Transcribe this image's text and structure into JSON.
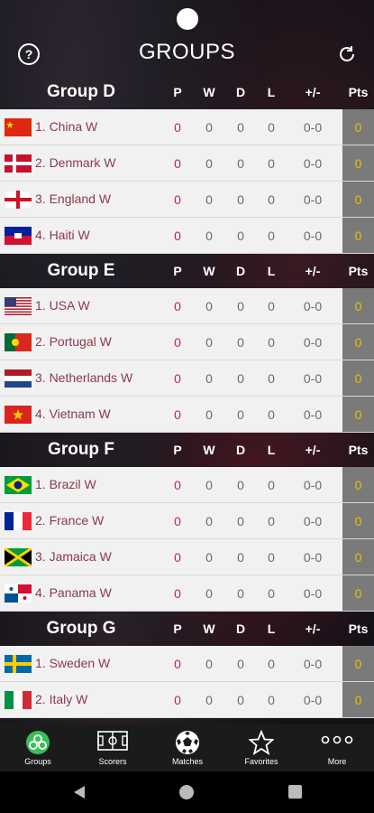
{
  "app": {
    "title": "GROUPS"
  },
  "columns": {
    "p": "P",
    "w": "W",
    "d": "D",
    "l": "L",
    "gd": "+/-",
    "pts": "Pts"
  },
  "groups": [
    {
      "name": "Group D",
      "teams": [
        {
          "pos_name": "1. China W",
          "p": "0",
          "w": "0",
          "d": "0",
          "l": "0",
          "gd": "0-0",
          "pts": "0",
          "flag": "china-flag"
        },
        {
          "pos_name": "2. Denmark W",
          "p": "0",
          "w": "0",
          "d": "0",
          "l": "0",
          "gd": "0-0",
          "pts": "0",
          "flag": "denmark-flag"
        },
        {
          "pos_name": "3. England W",
          "p": "0",
          "w": "0",
          "d": "0",
          "l": "0",
          "gd": "0-0",
          "pts": "0",
          "flag": "england-flag"
        },
        {
          "pos_name": "4. Haiti W",
          "p": "0",
          "w": "0",
          "d": "0",
          "l": "0",
          "gd": "0-0",
          "pts": "0",
          "flag": "haiti-flag"
        }
      ]
    },
    {
      "name": "Group E",
      "teams": [
        {
          "pos_name": "1. USA W",
          "p": "0",
          "w": "0",
          "d": "0",
          "l": "0",
          "gd": "0-0",
          "pts": "0",
          "flag": "usa-flag"
        },
        {
          "pos_name": "2. Portugal W",
          "p": "0",
          "w": "0",
          "d": "0",
          "l": "0",
          "gd": "0-0",
          "pts": "0",
          "flag": "portugal-flag"
        },
        {
          "pos_name": "3. Netherlands W",
          "p": "0",
          "w": "0",
          "d": "0",
          "l": "0",
          "gd": "0-0",
          "pts": "0",
          "flag": "netherlands-flag"
        },
        {
          "pos_name": "4. Vietnam W",
          "p": "0",
          "w": "0",
          "d": "0",
          "l": "0",
          "gd": "0-0",
          "pts": "0",
          "flag": "vietnam-flag"
        }
      ]
    },
    {
      "name": "Group F",
      "teams": [
        {
          "pos_name": "1. Brazil W",
          "p": "0",
          "w": "0",
          "d": "0",
          "l": "0",
          "gd": "0-0",
          "pts": "0",
          "flag": "brazil-flag"
        },
        {
          "pos_name": "2. France W",
          "p": "0",
          "w": "0",
          "d": "0",
          "l": "0",
          "gd": "0-0",
          "pts": "0",
          "flag": "france-flag"
        },
        {
          "pos_name": "3. Jamaica W",
          "p": "0",
          "w": "0",
          "d": "0",
          "l": "0",
          "gd": "0-0",
          "pts": "0",
          "flag": "jamaica-flag"
        },
        {
          "pos_name": "4. Panama W",
          "p": "0",
          "w": "0",
          "d": "0",
          "l": "0",
          "gd": "0-0",
          "pts": "0",
          "flag": "panama-flag"
        }
      ]
    },
    {
      "name": "Group G",
      "teams": [
        {
          "pos_name": "1. Sweden W",
          "p": "0",
          "w": "0",
          "d": "0",
          "l": "0",
          "gd": "0-0",
          "pts": "0",
          "flag": "sweden-flag"
        },
        {
          "pos_name": "2. Italy W",
          "p": "0",
          "w": "0",
          "d": "0",
          "l": "0",
          "gd": "0-0",
          "pts": "0",
          "flag": "italy-flag"
        }
      ]
    }
  ],
  "tabs": [
    {
      "label": "Groups",
      "icon": "groups-icon",
      "active": true
    },
    {
      "label": "Scorers",
      "icon": "pitch-icon"
    },
    {
      "label": "Matches",
      "icon": "ball-icon"
    },
    {
      "label": "Favorites",
      "icon": "star-icon"
    },
    {
      "label": "More",
      "icon": "more-icon"
    }
  ],
  "colors": {
    "accent": "#3bbd5a",
    "pts": "#e8c000",
    "team_text": "#8a3a4a"
  }
}
